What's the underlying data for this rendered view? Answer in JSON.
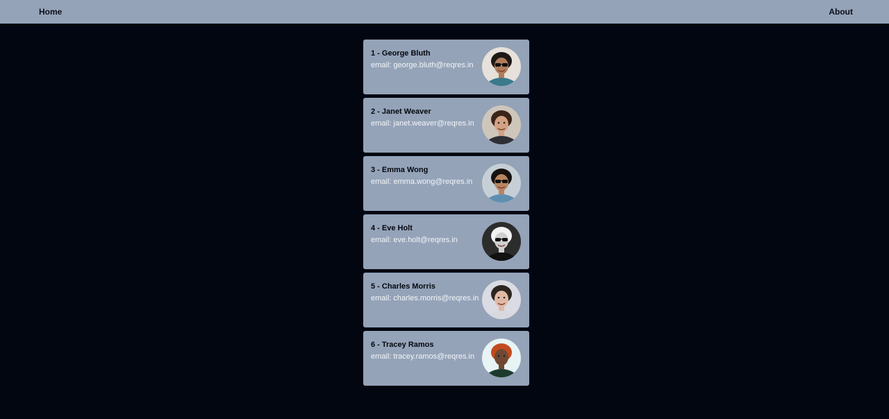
{
  "nav": {
    "home_label": "Home",
    "about_label": "About"
  },
  "users": [
    {
      "id": "1",
      "name_line": "1 - George Bluth",
      "email_line": "email: george.bluth@reqres.in",
      "avatar": {
        "bg": "#e6e1da",
        "skin": "#b07d5b",
        "hair": "#1e1915",
        "shirt": "#3a7a8a",
        "glasses": true
      }
    },
    {
      "id": "2",
      "name_line": "2 - Janet Weaver",
      "email_line": "email: janet.weaver@reqres.in",
      "avatar": {
        "bg": "#cfc6bb",
        "skin": "#d2a283",
        "hair": "#3b2418",
        "shirt": "#2e2f35",
        "glasses": false
      }
    },
    {
      "id": "3",
      "name_line": "3 - Emma Wong",
      "email_line": "email: emma.wong@reqres.in",
      "avatar": {
        "bg": "#c7cfd6",
        "skin": "#b88561",
        "hair": "#16120f",
        "shirt": "#5f8fb0",
        "glasses": true
      }
    },
    {
      "id": "4",
      "name_line": "4 - Eve Holt",
      "email_line": "email: eve.holt@reqres.in",
      "avatar": {
        "bg": "#2c2c2c",
        "skin": "#cfcfcf",
        "hair": "#f2f2f2",
        "shirt": "#111111",
        "glasses": true
      }
    },
    {
      "id": "5",
      "name_line": "5 - Charles Morris",
      "email_line": "email: charles.morris@reqres.in",
      "avatar": {
        "bg": "#dadbe3",
        "skin": "#e0b9a5",
        "hair": "#2d2420",
        "shirt": "#d8d8df",
        "glasses": false
      }
    },
    {
      "id": "6",
      "name_line": "6 - Tracey Ramos",
      "email_line": "email: tracey.ramos@reqres.in",
      "avatar": {
        "bg": "#e8f4f4",
        "skin": "#6e4a34",
        "hair": "#c44a1e",
        "shirt": "#1c3b2e",
        "glasses": false
      }
    }
  ]
}
